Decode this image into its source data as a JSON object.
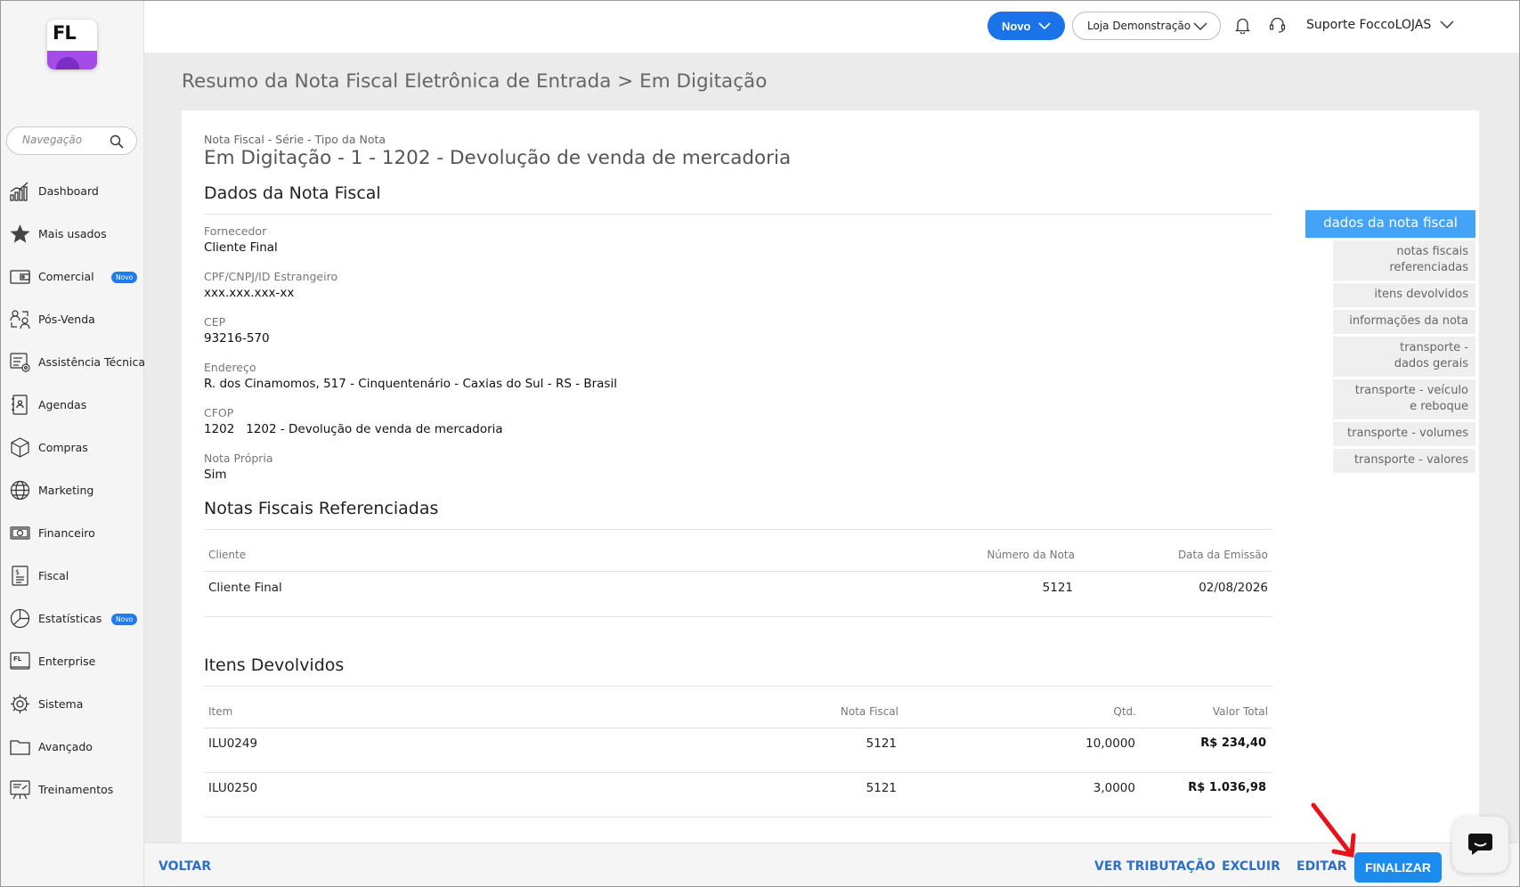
{
  "sidebar": {
    "logo_text": "FL",
    "search_placeholder": "Navegação",
    "items": [
      {
        "label": "Dashboard"
      },
      {
        "label": "Mais usados"
      },
      {
        "label": "Comercial",
        "badge": "Novo"
      },
      {
        "label": "Pós-Venda"
      },
      {
        "label": "Assistência Técnica"
      },
      {
        "label": "Agendas"
      },
      {
        "label": "Compras"
      },
      {
        "label": "Marketing"
      },
      {
        "label": "Financeiro"
      },
      {
        "label": "Fiscal"
      },
      {
        "label": "Estatísticas",
        "badge": "Novo"
      },
      {
        "label": "Enterprise"
      },
      {
        "label": "Sistema"
      },
      {
        "label": "Avançado"
      },
      {
        "label": "Treinamentos"
      }
    ]
  },
  "header": {
    "new_button": "Novo",
    "store": "Loja Demonstração",
    "user": "Suporte FoccoLOJAS"
  },
  "page_title": "Resumo da Nota Fiscal Eletrônica de Entrada > Em Digitação",
  "note": {
    "caption": "Nota Fiscal - Série - Tipo da Nota",
    "heading": "Em Digitação - 1 - 1202 - Devolução de venda de mercadoria"
  },
  "dados": {
    "title": "Dados da Nota Fiscal",
    "fields": [
      {
        "label": "Fornecedor",
        "value": "Cliente Final"
      },
      {
        "label": "CPF/CNPJ/ID Estrangeiro",
        "value": "xxx.xxx.xxx-xx"
      },
      {
        "label": "CEP",
        "value": "93216-570"
      },
      {
        "label": "Endereço",
        "value": "R. dos Cinamomos, 517 - Cinquentenário - Caxias do Sul - RS - Brasil"
      },
      {
        "label": "CFOP",
        "value": "1202   1202 - Devolução de venda de mercadoria"
      },
      {
        "label": "Nota Própria",
        "value": "Sim"
      }
    ]
  },
  "referenced": {
    "title": "Notas Fiscais Referenciadas",
    "columns": [
      "Cliente",
      "Número da Nota",
      "Data da Emissão"
    ],
    "rows": [
      [
        "Cliente Final",
        "5121",
        "02/08/2026"
      ]
    ]
  },
  "items": {
    "title": "Itens Devolvidos",
    "columns": [
      "Item",
      "Nota Fiscal",
      "Qtd.",
      "Valor Total"
    ],
    "rows": [
      [
        "ILU0249",
        "5121",
        "10,0000",
        "R$ 234,40"
      ],
      [
        "ILU0250",
        "5121",
        "3,0000",
        "R$ 1.036,98"
      ]
    ]
  },
  "anchors": [
    "dados da nota fiscal",
    "notas fiscais referenciadas",
    "itens devolvidos",
    "informações da nota",
    "transporte - dados gerais",
    "transporte - veículo e reboque",
    "transporte - volumes",
    "transporte - valores"
  ],
  "bottom": {
    "back": "VOLTAR",
    "tax": "VER TRIBUTAÇÃO",
    "delete": "EXCLUIR",
    "edit": "EDITAR",
    "finish": "FINALIZAR"
  },
  "colors": {
    "primary": "#1a73e8",
    "anchor_active": "#45a3f5",
    "link": "#2b6fc6",
    "annotation_arrow": "#e8121b"
  }
}
